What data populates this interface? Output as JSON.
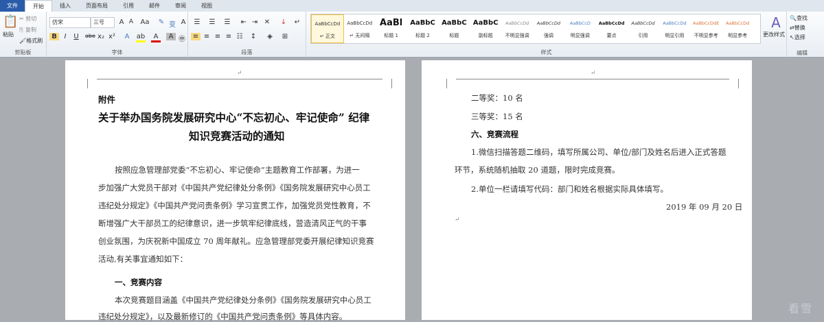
{
  "tabs": [
    "文件",
    "开始",
    "插入",
    "页面布局",
    "引用",
    "邮件",
    "审阅",
    "视图"
  ],
  "clipboard": {
    "paste": "粘贴",
    "cut": "剪切",
    "copy": "复制",
    "format_painter": "格式刷",
    "label": "剪贴板"
  },
  "font": {
    "name": "仿宋",
    "size": "三号",
    "label": "字体"
  },
  "paragraph": {
    "label": "段落"
  },
  "styles": {
    "label": "样式",
    "items": [
      {
        "preview": "AaBbCcDd",
        "name": "↵ 正文"
      },
      {
        "preview": "AaBbCcDd",
        "name": "↵ 无间隔"
      },
      {
        "preview": "AaBl",
        "name": "标题 1"
      },
      {
        "preview": "AaBbC",
        "name": "标题 2"
      },
      {
        "preview": "AaBbC",
        "name": "标题"
      },
      {
        "preview": "AaBbC",
        "name": "副标题"
      },
      {
        "preview": "AaBbCcDd",
        "name": "不明显强调"
      },
      {
        "preview": "AaBbCcDd",
        "name": "强调"
      },
      {
        "preview": "AaBbCcD",
        "name": "明显强调"
      },
      {
        "preview": "AaBbCcDd",
        "name": "要点"
      },
      {
        "preview": "AaBbCcDd",
        "name": "引用"
      },
      {
        "preview": "AaBbCcDd",
        "name": "明显引用"
      },
      {
        "preview": "AaBbCcDdE",
        "name": "不明显参考"
      },
      {
        "preview": "AaBbCcDd",
        "name": "明显参考"
      }
    ],
    "change": "更改样式"
  },
  "editing": {
    "find": "查找",
    "replace": "替换",
    "select": "选择",
    "label": "编辑"
  },
  "left_page": {
    "attachment": "附件",
    "title1": "关于举办国务院发展研究中心“不忘初心、牢记使命” 纪律",
    "title2": "知识竞赛活动的通知",
    "body": [
      "按照应急管理部党委“不忘初心、牢记使命”主题教育工作部署，为进一",
      "步加强广大党员干部对《中国共产党纪律处分条例》《国务院发展研究中心员工",
      "违纪处分规定》《中国共产党问责条例》学习宣贯工作，加强党员党性教育，不",
      "断增强广大干部员工的纪律意识，进一步筑牢纪律底线，营造清风正气的干事",
      "创业氛围，为庆祝新中国成立 70 周年献礼。应急管理部党委开展纪律知识竞赛",
      "活动,有关事宜通知如下："
    ],
    "section1": "一、竞赛内容",
    "body2": [
      "本次竞赛题目涵盖《中国共产党纪律处分条例》《国务院发展研究中心员工",
      "违纪处分规定》，以及最新修订的《中国共产党问责条例》等具体内容。"
    ]
  },
  "right_page": {
    "lines": [
      "二等奖：10 名",
      "三等奖：15 名"
    ],
    "section6": "六、竞赛流程",
    "p1": [
      "1.微信扫描答题二维码，填写所属公司、单位/部门及姓名后进入正式答题",
      "环节，系统随机抽取 20 道题，限时完成竞赛。"
    ],
    "p2": "2.单位一栏请填写代码：部门和姓名根据实际具体填写。",
    "date": "2019 年 09 月 20 日"
  },
  "watermark": "看雪"
}
